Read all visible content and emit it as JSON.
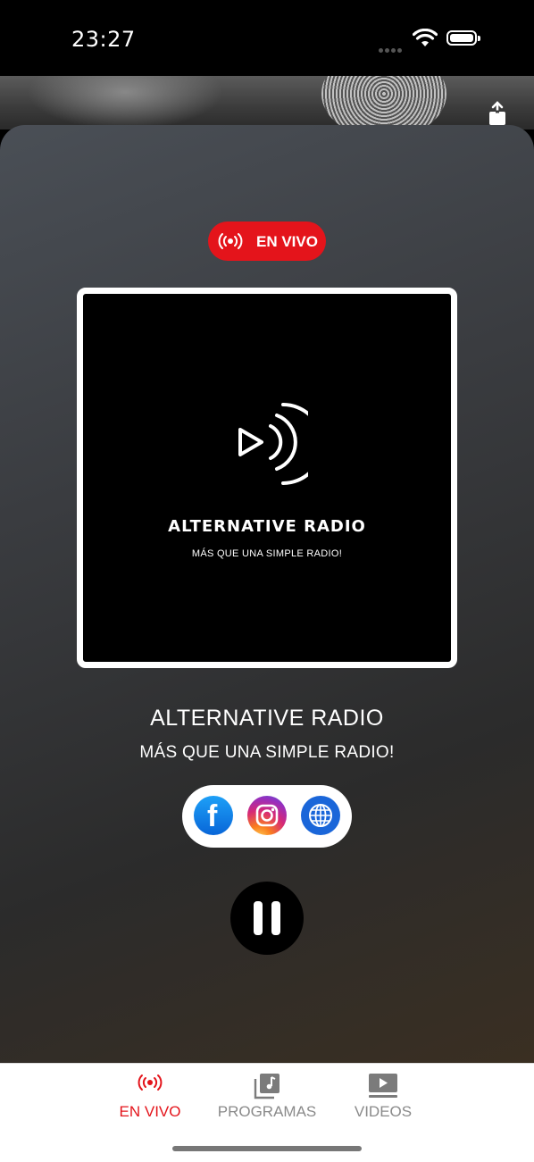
{
  "status_bar": {
    "time": "23:27"
  },
  "badge": {
    "label": "EN VIVO"
  },
  "artwork": {
    "title": "ALTERNATIVE RADIO",
    "subtitle": "MÁS QUE UNA SIMPLE RADIO!"
  },
  "station": {
    "title": "ALTERNATIVE RADIO",
    "subtitle": "MÁS QUE UNA SIMPLE RADIO!"
  },
  "social": [
    "facebook-icon",
    "instagram-icon",
    "globe-icon"
  ],
  "player": {
    "state": "playing"
  },
  "tabs": [
    {
      "label": "EN VIVO",
      "active": true
    },
    {
      "label": "PROGRAMAS",
      "active": false
    },
    {
      "label": "VIDEOS",
      "active": false
    }
  ],
  "colors": {
    "accent": "#e4141b",
    "tab_inactive": "#8a8a8a"
  }
}
